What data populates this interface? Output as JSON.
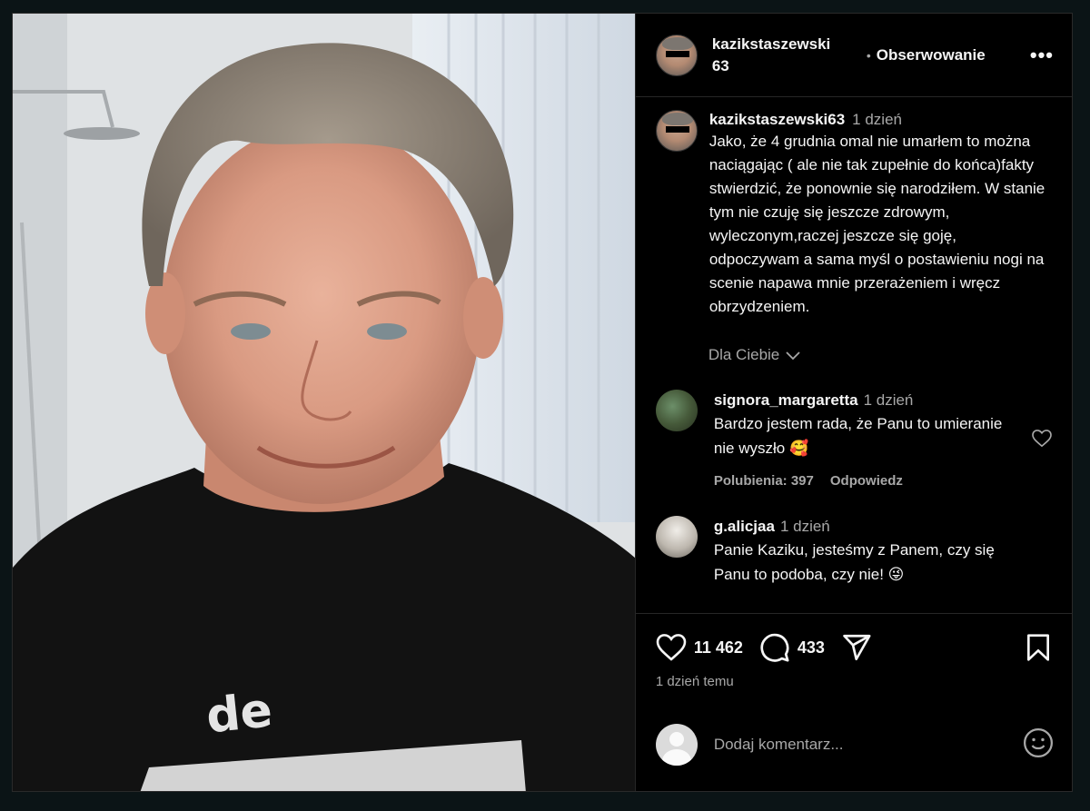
{
  "post": {
    "username": "kazikstaszewski63",
    "header_username": "kazikstaszewski\n63",
    "follow_separator": "•",
    "follow_label": "Obserwowanie",
    "more_label": "•••",
    "caption_time": "1 dzień",
    "caption_text": "Jako, że 4 grudnia omal nie umarłem to można naciągając ( ale nie tak zupełnie do końca)fakty stwierdzić, że ponownie się narodziłem. W stanie tym nie czuję się jeszcze zdrowym, wyleczonym,raczej jeszcze się goję, odpoczywam a sama myśl o postawieniu nogi na scenie napawa mnie przerażeniem i wręcz obrzydzeniem.",
    "for_you_label": "Dla Ciebie",
    "shirt_text": "de"
  },
  "comments": [
    {
      "user": "signora_margaretta",
      "time": "1 dzień",
      "text": "Bardzo jestem rada, że Panu to umieranie nie wyszło 🥰",
      "likes_label": "Polubienia: 397",
      "reply_label": "Odpowiedz"
    },
    {
      "user": "g.alicjaa",
      "time": "1 dzień",
      "text": "Panie Kaziku, jesteśmy z Panem, czy się Panu to podoba, czy nie! 😜"
    }
  ],
  "actions": {
    "likes": "11 462",
    "comments": "433",
    "posted_ago": "1 dzień temu"
  },
  "add_comment": {
    "placeholder": "Dodaj komentarz..."
  },
  "icons": {
    "like": "heart-icon",
    "comment": "comment-bubble-icon",
    "share": "paper-plane-icon",
    "save": "bookmark-icon",
    "emoji": "smiley-icon",
    "more": "ellipsis-icon",
    "chevron": "chevron-down-icon"
  },
  "colors": {
    "background": "#000000",
    "text": "#f5f5f5",
    "secondary": "#a8a8a8",
    "divider": "#262626",
    "shirt": "#121212"
  }
}
